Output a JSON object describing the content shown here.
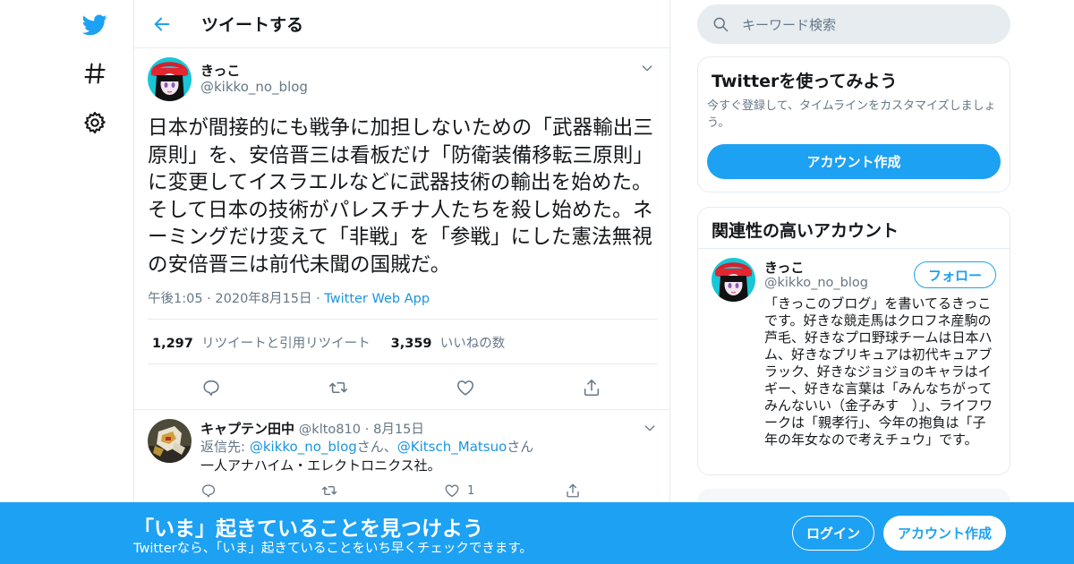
{
  "colors": {
    "brand": "#1da1f2",
    "link": "#1b95e0",
    "muted": "#657786",
    "border": "#e6ecf0"
  },
  "nav": {
    "icons": [
      "twitter-logo-icon",
      "hashtag-icon",
      "gear-icon"
    ]
  },
  "header": {
    "title": "ツイートする"
  },
  "tweet": {
    "name": "きっこ",
    "handle": "@kikko_no_blog",
    "text": "日本が間接的にも戦争に加担しないための「武器輸出三原則」を、安倍晋三は看板だけ「防衛装備移転三原則」に変更してイスラエルなどに武器技術の輸出を始めた。そして日本の技術がパレスチナ人たちを殺し始めた。ネーミングだけ変えて「非戦」を「参戦」にした憲法無視の安倍晋三は前代未聞の国賊だ。",
    "time": "午後1:05",
    "date": "2020年8月15日",
    "source": "Twitter Web App",
    "retweets": "1,297",
    "retweets_label": "リツイートと引用リツイート",
    "likes": "3,359",
    "likes_label": "いいねの数"
  },
  "reply": {
    "name": "キャプテン田中",
    "handle": "@klto810",
    "date": "8月15日",
    "reply_prefix": "返信先: ",
    "reply_to_1": "@kikko_no_blog",
    "san1": "さん、",
    "reply_to_2": "@Kitsch_Matsuo",
    "san2": "さん",
    "text": "一人アナハイム・エレクトロニクス社。",
    "like_count": "1"
  },
  "search": {
    "placeholder": "キーワード検索"
  },
  "signup_card": {
    "title": "Twitterを使ってみよう",
    "subtitle": "今すぐ登録して、タイムラインをカスタマイズしましょう。",
    "button": "アカウント作成"
  },
  "related": {
    "title": "関連性の高いアカウント",
    "name": "きっこ",
    "handle": "@kikko_no_blog",
    "follow": "フォロー",
    "bio": "「きっこのブログ」を書いてるきっこです。好きな競走馬はクロフネ産駒の芦毛、好きなプロ野球チームは日本ハム、好きなプリキュアは初代キュアブラック、好きなジョジョのキャラはイギー、好きな言葉は「みんなちがってみんないい（金子みす　）」、ライフワークは「親孝行」、今年の抱負は「子年の年女なので考えチュウ」です。"
  },
  "banner": {
    "title": "「いま」起きていることを見つけよう",
    "subtitle": "Twitterなら、「いま」起きていることをいち早くチェックできます。",
    "login": "ログイン",
    "signup": "アカウント作成"
  }
}
